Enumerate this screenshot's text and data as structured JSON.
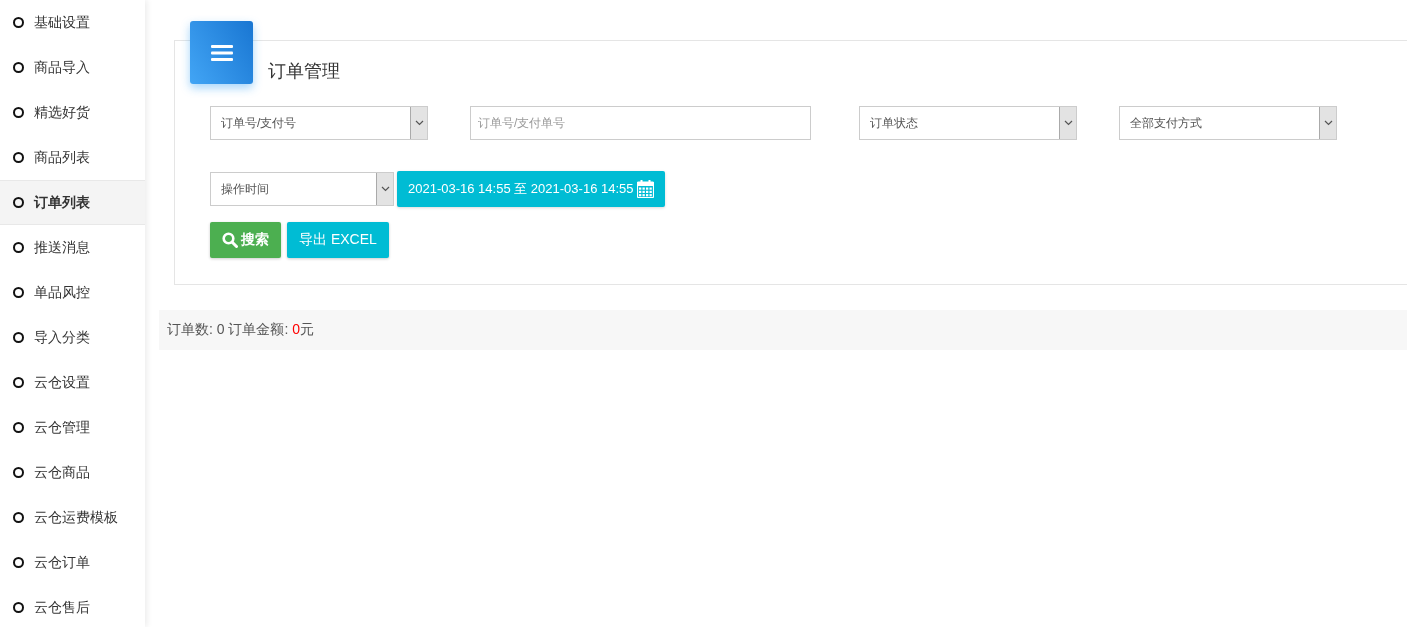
{
  "sidebar": {
    "items": [
      {
        "label": "基础设置",
        "selected": false
      },
      {
        "label": "商品导入",
        "selected": false
      },
      {
        "label": "精选好货",
        "selected": false
      },
      {
        "label": "商品列表",
        "selected": false
      },
      {
        "label": "订单列表",
        "selected": true
      },
      {
        "label": "推送消息",
        "selected": false
      },
      {
        "label": "单品风控",
        "selected": false
      },
      {
        "label": "导入分类",
        "selected": false
      },
      {
        "label": "云仓设置",
        "selected": false
      },
      {
        "label": "云仓管理",
        "selected": false
      },
      {
        "label": "云仓商品",
        "selected": false
      },
      {
        "label": "云仓运费模板",
        "selected": false
      },
      {
        "label": "云仓订单",
        "selected": false
      },
      {
        "label": "云仓售后",
        "selected": false
      }
    ]
  },
  "panel": {
    "title": "订单管理",
    "filters": [
      {
        "kind": "select",
        "value": "订单号/支付号"
      },
      {
        "kind": "input",
        "placeholder": "订单号/支付单号"
      },
      {
        "kind": "select",
        "value": "订单状态"
      },
      {
        "kind": "select",
        "value": "全部支付方式"
      }
    ],
    "time_filter": {
      "value": "操作时间"
    },
    "date_range": "2021-03-16 14:55 至 2021-03-16 14:55",
    "buttons": [
      {
        "kind": "search",
        "label": "搜索"
      },
      {
        "kind": "export",
        "label": "导出 EXCEL"
      }
    ]
  },
  "summary": {
    "orders_label": "订单数:",
    "orders_count": "0",
    "amount_label": "订单金额:",
    "amount_value": "0",
    "amount_unit": "元"
  }
}
